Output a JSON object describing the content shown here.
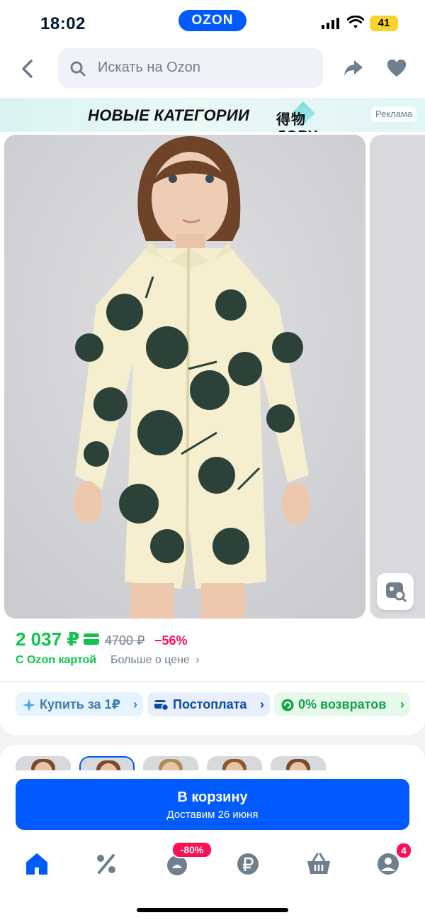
{
  "status": {
    "time": "18:02",
    "app_pill": "OZON",
    "battery": "41"
  },
  "header": {
    "search_placeholder": "Искать на Ozon"
  },
  "ad": {
    "title": "НОВЫЕ КАТЕГОРИИ",
    "brand": "得物ДЭВУ",
    "tag": "Реклама"
  },
  "price": {
    "current": "2 037 ₽",
    "old": "4700 ₽",
    "discount": "−56%",
    "card_label": "С Ozon картой",
    "more_label": "Больше о цене"
  },
  "chips": [
    {
      "label": "Купить за 1₽"
    },
    {
      "label": "Постоплата"
    },
    {
      "label": "0% возвратов"
    }
  ],
  "cart": {
    "label": "В корзину",
    "delivery": "Доставим 26 июня"
  },
  "tabbar": {
    "items": [
      {
        "name": "home",
        "icon": "home-icon"
      },
      {
        "name": "sale",
        "icon": "percent-icon"
      },
      {
        "name": "fresh",
        "icon": "bag-icon",
        "badge": "-80%"
      },
      {
        "name": "finance",
        "icon": "ruble-icon"
      },
      {
        "name": "cart",
        "icon": "basket-icon"
      },
      {
        "name": "profile",
        "icon": "profile-icon",
        "badge": "4"
      }
    ]
  },
  "colors": {
    "accent": "#005bff",
    "green": "#10c44c",
    "pink": "#f91155"
  }
}
